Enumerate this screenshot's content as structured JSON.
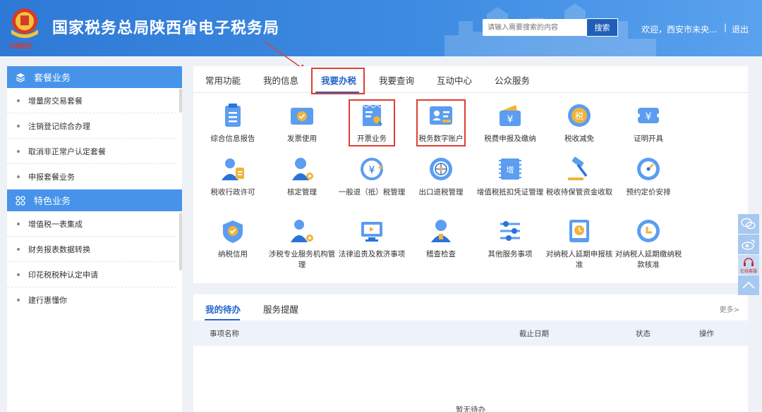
{
  "header": {
    "emblem_text": "中国税务",
    "title": "国家税务总局陕西省电子税务局",
    "search_placeholder": "请输入需要搜索的内容",
    "search_button": "搜索",
    "welcome": "欢迎，西安市未央...",
    "separator": "|",
    "logout": "退出"
  },
  "sidebar": {
    "sections": [
      {
        "title": "套餐业务",
        "icon": "layers-icon",
        "items": [
          "增量房交易套餐",
          "注销登记综合办理",
          "取消非正常户认定套餐",
          "申报套餐业务"
        ]
      },
      {
        "title": "特色业务",
        "icon": "grid-icon",
        "items": [
          "增值税一表集成",
          "财务报表数据转换",
          "印花税税种认定申请",
          "建行惠懂你"
        ]
      }
    ]
  },
  "main": {
    "tabs": [
      "常用功能",
      "我的信息",
      "我要办税",
      "我要查询",
      "互动中心",
      "公众服务"
    ],
    "active_tab": "我要办税",
    "items": [
      {
        "label": "综合信息报告",
        "icon": "report-icon"
      },
      {
        "label": "发票使用",
        "icon": "invoice-check-icon"
      },
      {
        "label": "开票业务",
        "icon": "invoice-search-icon"
      },
      {
        "label": "税务数字账户",
        "icon": "digital-account-icon"
      },
      {
        "label": "税费申报及缴纳",
        "icon": "wallet-yen-icon"
      },
      {
        "label": "税收减免",
        "icon": "tax-reduction-icon"
      },
      {
        "label": "证明开具",
        "icon": "certificate-icon"
      },
      {
        "label": "税收行政许可",
        "icon": "admin-license-icon"
      },
      {
        "label": "核定管理",
        "icon": "assessment-icon"
      },
      {
        "label": "一般退（抵）税管理",
        "icon": "refund-icon"
      },
      {
        "label": "出口退税管理",
        "icon": "export-refund-icon"
      },
      {
        "label": "增值税抵扣凭证管理",
        "icon": "vat-deduction-icon"
      },
      {
        "label": "税收待保管资金收取",
        "icon": "gavel-icon"
      },
      {
        "label": "预约定价安排",
        "icon": "pricing-icon"
      },
      {
        "label": "纳税信用",
        "icon": "credit-icon"
      },
      {
        "label": "涉税专业服务机构管理",
        "icon": "agency-icon"
      },
      {
        "label": "法律追责及救济事项",
        "icon": "legal-icon"
      },
      {
        "label": "稽查检查",
        "icon": "inspection-icon"
      },
      {
        "label": "其他服务事项",
        "icon": "sliders-icon"
      },
      {
        "label": "对纳税人延期申报核准",
        "icon": "clock-doc-icon"
      },
      {
        "label": "对纳税人延期缴纳税款核准",
        "icon": "clock-icon"
      }
    ]
  },
  "todo": {
    "tabs": [
      "我的待办",
      "服务提醒"
    ],
    "more": "更多>",
    "columns": [
      "事项名称",
      "截止日期",
      "状态",
      "操作"
    ],
    "empty_text": "暂无待办"
  },
  "float": {
    "online_label": "在线客服"
  },
  "colors": {
    "header": "#3d8be2",
    "accent": "#2466c7",
    "sidebar_header": "#4793ea",
    "highlight": "#e03d35"
  }
}
